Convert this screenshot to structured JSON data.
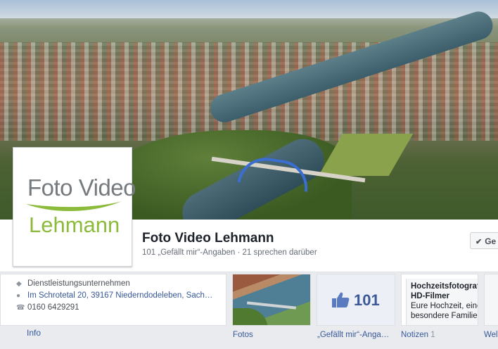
{
  "page": {
    "name": "Foto Video Lehmann",
    "stats": "101 „Gefällt mir“-Angaben · 21 sprechen darüber",
    "like_button_label": "Ge"
  },
  "logo": {
    "line1": "Foto Video",
    "line2": "Lehmann",
    "text_color": "#757a7e",
    "accent_color": "#8cbb3c"
  },
  "info": {
    "category": "Dienstleistungsunternehmen",
    "address": "Im Schrotetal 20, 39167 Niederndodeleben, Sach…",
    "phone": "0160 6429291",
    "label": "Info"
  },
  "apps": [
    {
      "label": "Fotos",
      "count": ""
    },
    {
      "label": "„Gefällt mir“-Anga…",
      "value": "101",
      "count": ""
    },
    {
      "label": "Notizen",
      "count": "1",
      "lines": [
        "Hochzeitsfotograf",
        "HD-Filmer",
        "Eure Hochzeit, eine",
        "besondere Familien"
      ]
    },
    {
      "label": "Wel"
    }
  ],
  "colors": {
    "link": "#365899",
    "brand": "#3b5998",
    "background": "#e9ebee"
  }
}
